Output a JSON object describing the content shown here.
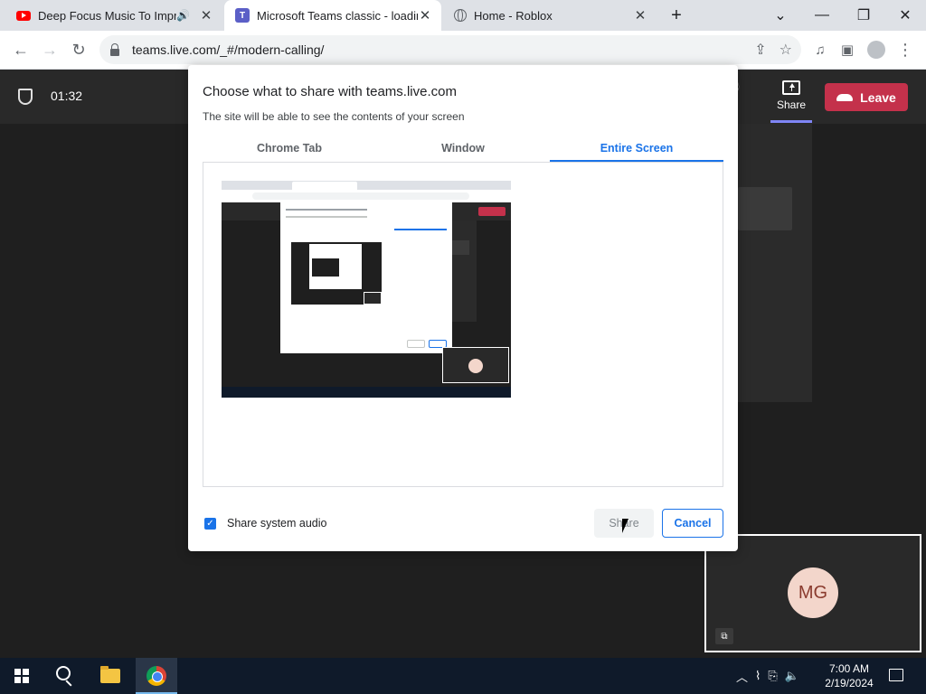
{
  "browser": {
    "tabs": [
      {
        "title": "Deep Focus Music To Impro",
        "icon": "youtube-icon",
        "active": false
      },
      {
        "title": "Microsoft Teams classic - loading",
        "icon": "teams-icon",
        "active": true
      },
      {
        "title": "Home - Roblox",
        "icon": "globe-icon",
        "active": false
      }
    ],
    "new_tab_label": "+",
    "url": "teams.live.com/_#/modern-calling/"
  },
  "teams": {
    "timer": "01:32",
    "share_label": "Share",
    "leave_label": "Leave",
    "self_initials": "MG",
    "colors": {
      "leave": "#c4314b",
      "accent": "#7f85f5"
    }
  },
  "dialog": {
    "title": "Choose what to share with teams.live.com",
    "subtitle": "The site will be able to see the contents of your screen",
    "tabs": [
      "Chrome Tab",
      "Window",
      "Entire Screen"
    ],
    "active_tab": "Entire Screen",
    "share_audio_label": "Share system audio",
    "share_audio_checked": true,
    "share_button": "Share",
    "cancel_button": "Cancel",
    "accent_color": "#1a73e8"
  },
  "taskbar": {
    "time": "7:00 AM",
    "date": "2/19/2024"
  }
}
